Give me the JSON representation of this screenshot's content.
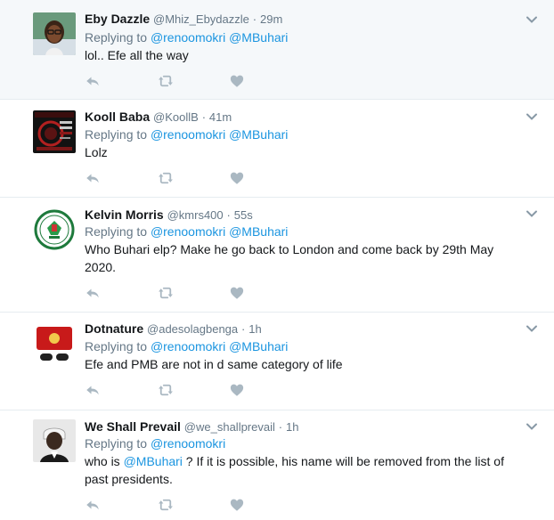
{
  "tweets": [
    {
      "name": "Eby Dazzle",
      "handle": "@Mhiz_Ebydazzle",
      "time": "29m",
      "replying_prefix": "Replying to",
      "replying_to": [
        "@renoomokri",
        "@MBuhari"
      ],
      "text": "lol.. Efe all the way",
      "avatar": "woman-glasses-avatar"
    },
    {
      "name": "Kooll Baba",
      "handle": "@KoollB",
      "time": "41m",
      "replying_prefix": "Replying to",
      "replying_to": [
        "@renoomokri",
        "@MBuhari"
      ],
      "text": "Lolz",
      "avatar": "poster-avatar"
    },
    {
      "name": "Kelvin Morris",
      "handle": "@kmrs400",
      "time": "55s",
      "replying_prefix": "Replying to",
      "replying_to": [
        "@renoomokri",
        "@MBuhari"
      ],
      "text": "Who Buhari elp? Make he go back to London and come back by 29th May 2020.",
      "avatar": "seal-avatar"
    },
    {
      "name": "Dotnature",
      "handle": "@adesolagbenga",
      "time": "1h",
      "replying_prefix": "Replying to",
      "replying_to": [
        "@renoomokri",
        "@MBuhari"
      ],
      "text": "Efe and PMB are not in d same category of life",
      "avatar": "console-avatar"
    },
    {
      "name": "We Shall Prevail",
      "handle": "@we_shallprevail",
      "time": "1h",
      "replying_prefix": "Replying to",
      "replying_to": [
        "@renoomokri"
      ],
      "text_before": "who is ",
      "text_mention": "@MBuhari",
      "text_after": " ? If it is possible, his name will be removed from the list of past presidents.",
      "avatar": "portrait-avatar"
    }
  ],
  "colors": {
    "link": "#1b95e0",
    "secondary": "#657786",
    "icon": "#aab8c2",
    "highlight_bg": "#f5f8fa"
  },
  "icons": [
    "reply-icon",
    "retweet-icon",
    "like-icon",
    "chevron-down-icon"
  ]
}
